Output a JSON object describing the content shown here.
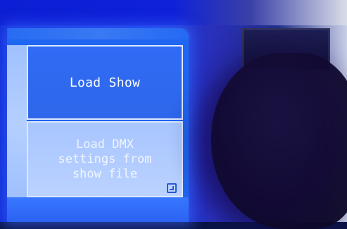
{
  "screen": {
    "tiles": [
      {
        "label": "Load Show"
      },
      {
        "label": "Load DMX\nsettings from\nshow file",
        "corner_icon": "submenu-arrow-icon"
      }
    ]
  },
  "colors": {
    "screen_blue": "#1f66f2",
    "tile_selected": "#2f6bf4",
    "tile_unselected": "#b6d0ff",
    "tile_border": "#dfe8ff"
  }
}
